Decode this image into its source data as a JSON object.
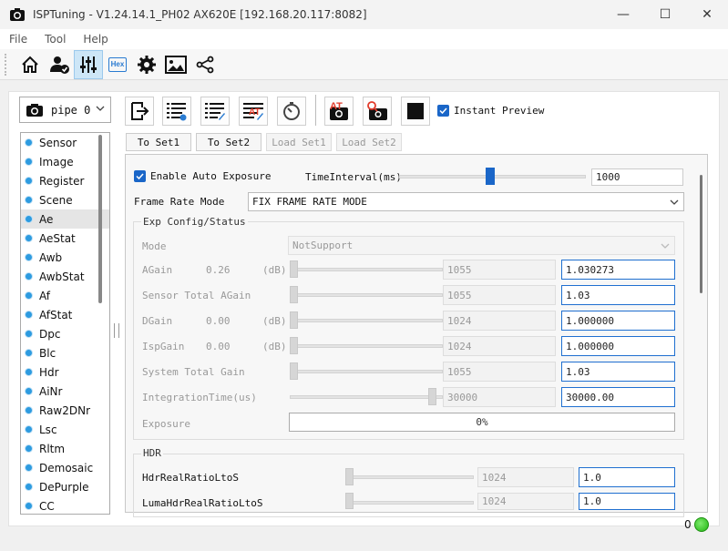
{
  "window": {
    "title": "ISPTuning - V1.24.14.1_PH02 AX620E [192.168.20.117:8082]",
    "min_label": "—",
    "max_label": "☐",
    "close_label": "✕"
  },
  "menu": [
    {
      "label": "File"
    },
    {
      "label": "Tool"
    },
    {
      "label": "Help"
    }
  ],
  "toolbar_icons": [
    "home-icon",
    "user-check-icon",
    "sliders-icon",
    "hex-icon",
    "gear-icon",
    "image-icon",
    "share-icon"
  ],
  "hex_label": "Hex",
  "pipe": {
    "label": "pipe 0"
  },
  "action_icons": [
    "export-icon",
    "list-check-icon",
    "list-edit-icon",
    "auto-tune-icon",
    "timer-icon",
    "at-camera-icon",
    "capture-icon",
    "stop-icon"
  ],
  "at_label": "AT",
  "instant_preview": {
    "label": "Instant Preview",
    "checked": true
  },
  "set_buttons": [
    {
      "label": "To Set1",
      "enabled": true
    },
    {
      "label": "To Set2",
      "enabled": true
    },
    {
      "label": "Load Set1",
      "enabled": false
    },
    {
      "label": "Load Set2",
      "enabled": false
    }
  ],
  "sidebar": {
    "items": [
      {
        "label": "Sensor"
      },
      {
        "label": "Image"
      },
      {
        "label": "Register"
      },
      {
        "label": "Scene"
      },
      {
        "label": "Ae"
      },
      {
        "label": "AeStat"
      },
      {
        "label": "Awb"
      },
      {
        "label": "AwbStat"
      },
      {
        "label": "Af"
      },
      {
        "label": "AfStat"
      },
      {
        "label": "Dpc"
      },
      {
        "label": "Blc"
      },
      {
        "label": "Hdr"
      },
      {
        "label": "AiNr"
      },
      {
        "label": "Raw2DNr"
      },
      {
        "label": "Lsc"
      },
      {
        "label": "Rltm"
      },
      {
        "label": "Demosaic"
      },
      {
        "label": "DePurple"
      },
      {
        "label": "CC"
      }
    ],
    "selected": "Ae"
  },
  "ae": {
    "enable_auto_exposure": {
      "label": "Enable Auto Exposure",
      "checked": true
    },
    "time_interval": {
      "label": "TimeInterval(ms)",
      "value": "1000",
      "slider_fraction": 0.5
    },
    "frame_rate_mode": {
      "label": "Frame Rate Mode",
      "value": "FIX FRAME RATE MODE"
    },
    "exp_config": {
      "title": "Exp Config/Status",
      "mode": {
        "label": "Mode",
        "value": "NotSupport"
      },
      "rows": [
        {
          "label": "AGain",
          "value": "0.26",
          "unit": "(dB)",
          "raw": "1055",
          "real": "1.030273",
          "slider_fraction": 0.0
        },
        {
          "label": "Sensor Total AGain",
          "value": "",
          "unit": "",
          "raw": "1055",
          "real": "1.03",
          "slider_fraction": 0.0
        },
        {
          "label": "DGain",
          "value": "0.00",
          "unit": "(dB)",
          "raw": "1024",
          "real": "1.000000",
          "slider_fraction": 0.0
        },
        {
          "label": "IspGain",
          "value": "0.00",
          "unit": "(dB)",
          "raw": "1024",
          "real": "1.000000",
          "slider_fraction": 0.0
        },
        {
          "label": "System Total Gain",
          "value": "",
          "unit": "",
          "raw": "1055",
          "real": "1.03",
          "slider_fraction": 0.0
        },
        {
          "label": "IntegrationTime(us)",
          "value": "",
          "unit": "",
          "raw": "30000",
          "real": "30000.00",
          "slider_fraction": 0.95
        }
      ],
      "exposure": {
        "label": "Exposure",
        "progress": "0%"
      }
    },
    "hdr": {
      "title": "HDR",
      "rows": [
        {
          "label": "HdrRealRatioLtoS",
          "raw": "1024",
          "real": "1.0"
        },
        {
          "label": "LumaHdrRealRatioLtoS",
          "raw": "1024",
          "real": "1.0"
        }
      ]
    }
  },
  "status": {
    "count": "0"
  }
}
